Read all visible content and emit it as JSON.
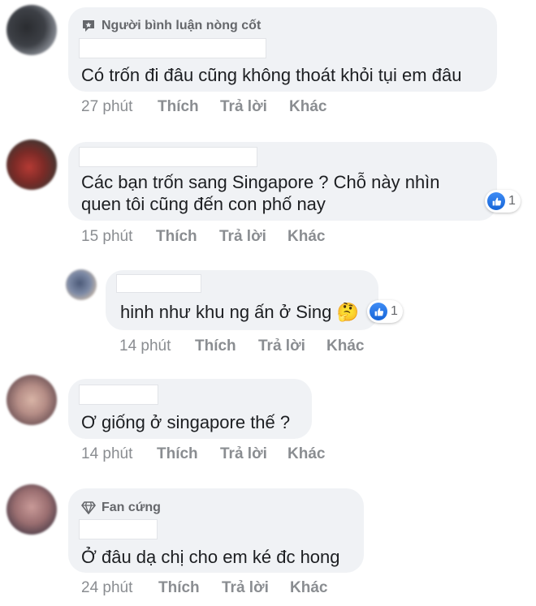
{
  "comments": [
    {
      "badge": "Người bình luận nòng cốt",
      "lines": [
        "Có trốn đi đâu cũng không thoát khỏi tụi em đâu"
      ],
      "time": "27 phút",
      "like": "Thích",
      "reply": "Trả lời",
      "more": "Khác"
    },
    {
      "lines": [
        "Các bạn trốn sang Singapore ? Chỗ này nhìn",
        "quen tôi cũng đến con phố nay"
      ],
      "reaction_count": "1",
      "time": "15 phút",
      "like": "Thích",
      "reply": "Trả lời",
      "more": "Khác"
    },
    {
      "lines": [
        "hinh như khu ng ấn ở Sing 🤔"
      ],
      "reaction_count": "1",
      "time": "14 phút",
      "like": "Thích",
      "reply": "Trả lời",
      "more": "Khác"
    },
    {
      "lines": [
        "Ơ giống ở singapore thế ?"
      ],
      "time": "14 phút",
      "like": "Thích",
      "reply": "Trả lời",
      "more": "Khác"
    },
    {
      "badge": "Fan cứng",
      "lines": [
        "Ở đâu dạ chị cho em ké đc hong"
      ],
      "time": "24 phút",
      "like": "Thích",
      "reply": "Trả lời",
      "more": "Khác"
    }
  ],
  "icons": {
    "top_commenter": "top-commenter-badge-icon",
    "fan": "diamond-icon",
    "like": "thumbs-up-icon"
  },
  "colors": {
    "bubble": "#f0f2f5",
    "meta": "#8a8d91",
    "like_blue": "#1877f2"
  }
}
